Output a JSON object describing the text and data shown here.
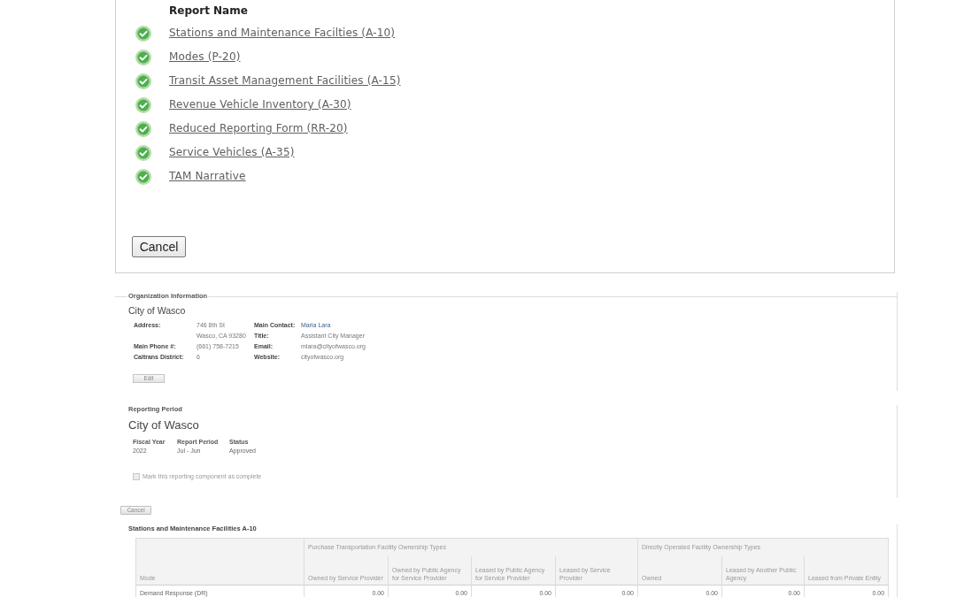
{
  "report_list": {
    "header": "Report Name",
    "items": [
      {
        "label": "Stations and Maintenance Facilties (A-10)",
        "complete": true
      },
      {
        "label": "Modes (P-20)",
        "complete": true
      },
      {
        "label": "Transit Asset Management Facilities (A-15)",
        "complete": true
      },
      {
        "label": "Revenue Vehicle Inventory (A-30)",
        "complete": true
      },
      {
        "label": "Reduced Reporting Form (RR-20)",
        "complete": true
      },
      {
        "label": "Service Vehicles (A-35)",
        "complete": true
      },
      {
        "label": "TAM Narrative",
        "complete": true
      }
    ],
    "cancel_button": "Cancel"
  },
  "organization": {
    "legend": "Organization Information",
    "name": "City of Wasco",
    "left_fields": [
      {
        "label": "Address:",
        "lines": [
          "746 8th St",
          "Wasco, CA 93280"
        ]
      },
      {
        "label": "Main Phone #:",
        "lines": [
          "(661) 758-7215"
        ]
      },
      {
        "label": "Caltrans District:",
        "lines": [
          "6"
        ]
      }
    ],
    "right_fields": [
      {
        "label": "Main Contact:",
        "lines": [
          "Maria Lara"
        ],
        "link": true
      },
      {
        "label": "Title:",
        "lines": [
          "Assistant City Manager"
        ],
        "link": false
      },
      {
        "label": "Email:",
        "lines": [
          "mlara@cityofwasco.org"
        ],
        "link": false
      },
      {
        "label": "Website:",
        "lines": [
          "cityofwasco.org"
        ],
        "link": false
      }
    ],
    "edit_button": "Edit"
  },
  "reporting_period": {
    "label": "Reporting Period",
    "name": "City of Wasco",
    "columns": [
      {
        "header": "Fiscal Year",
        "value": "2022"
      },
      {
        "header": "Report Period",
        "value": "Jul - Jun"
      },
      {
        "header": "Status",
        "value": "Approved"
      }
    ],
    "complete_checkbox": {
      "label": "Mark this reporting component as complete",
      "checked": false,
      "disabled": true
    }
  },
  "cancel_button": "Cancel",
  "facilities_table": {
    "title": "Stations and Maintenance Facilities A-10",
    "first_column": "Mode",
    "groups": [
      {
        "label": "Purchase Transportation Facility Ownership Types",
        "columns": [
          "Owned by Service Provider",
          "Owned by Public Agency for Service Provider",
          "Leased by Public Agency for Service Provider",
          "Leased by Service Provider"
        ]
      },
      {
        "label": "Directly Operated Facility Ownership Types",
        "columns": [
          "Owned",
          "Leased by Another Public Agency",
          "Leased from Private Entity"
        ]
      }
    ],
    "rows": [
      {
        "mode": "Demand Response (DR)",
        "values": [
          "0.00",
          "0.00",
          "0.00",
          "0.00",
          "0.00",
          "0.00",
          "0.00"
        ]
      }
    ]
  }
}
